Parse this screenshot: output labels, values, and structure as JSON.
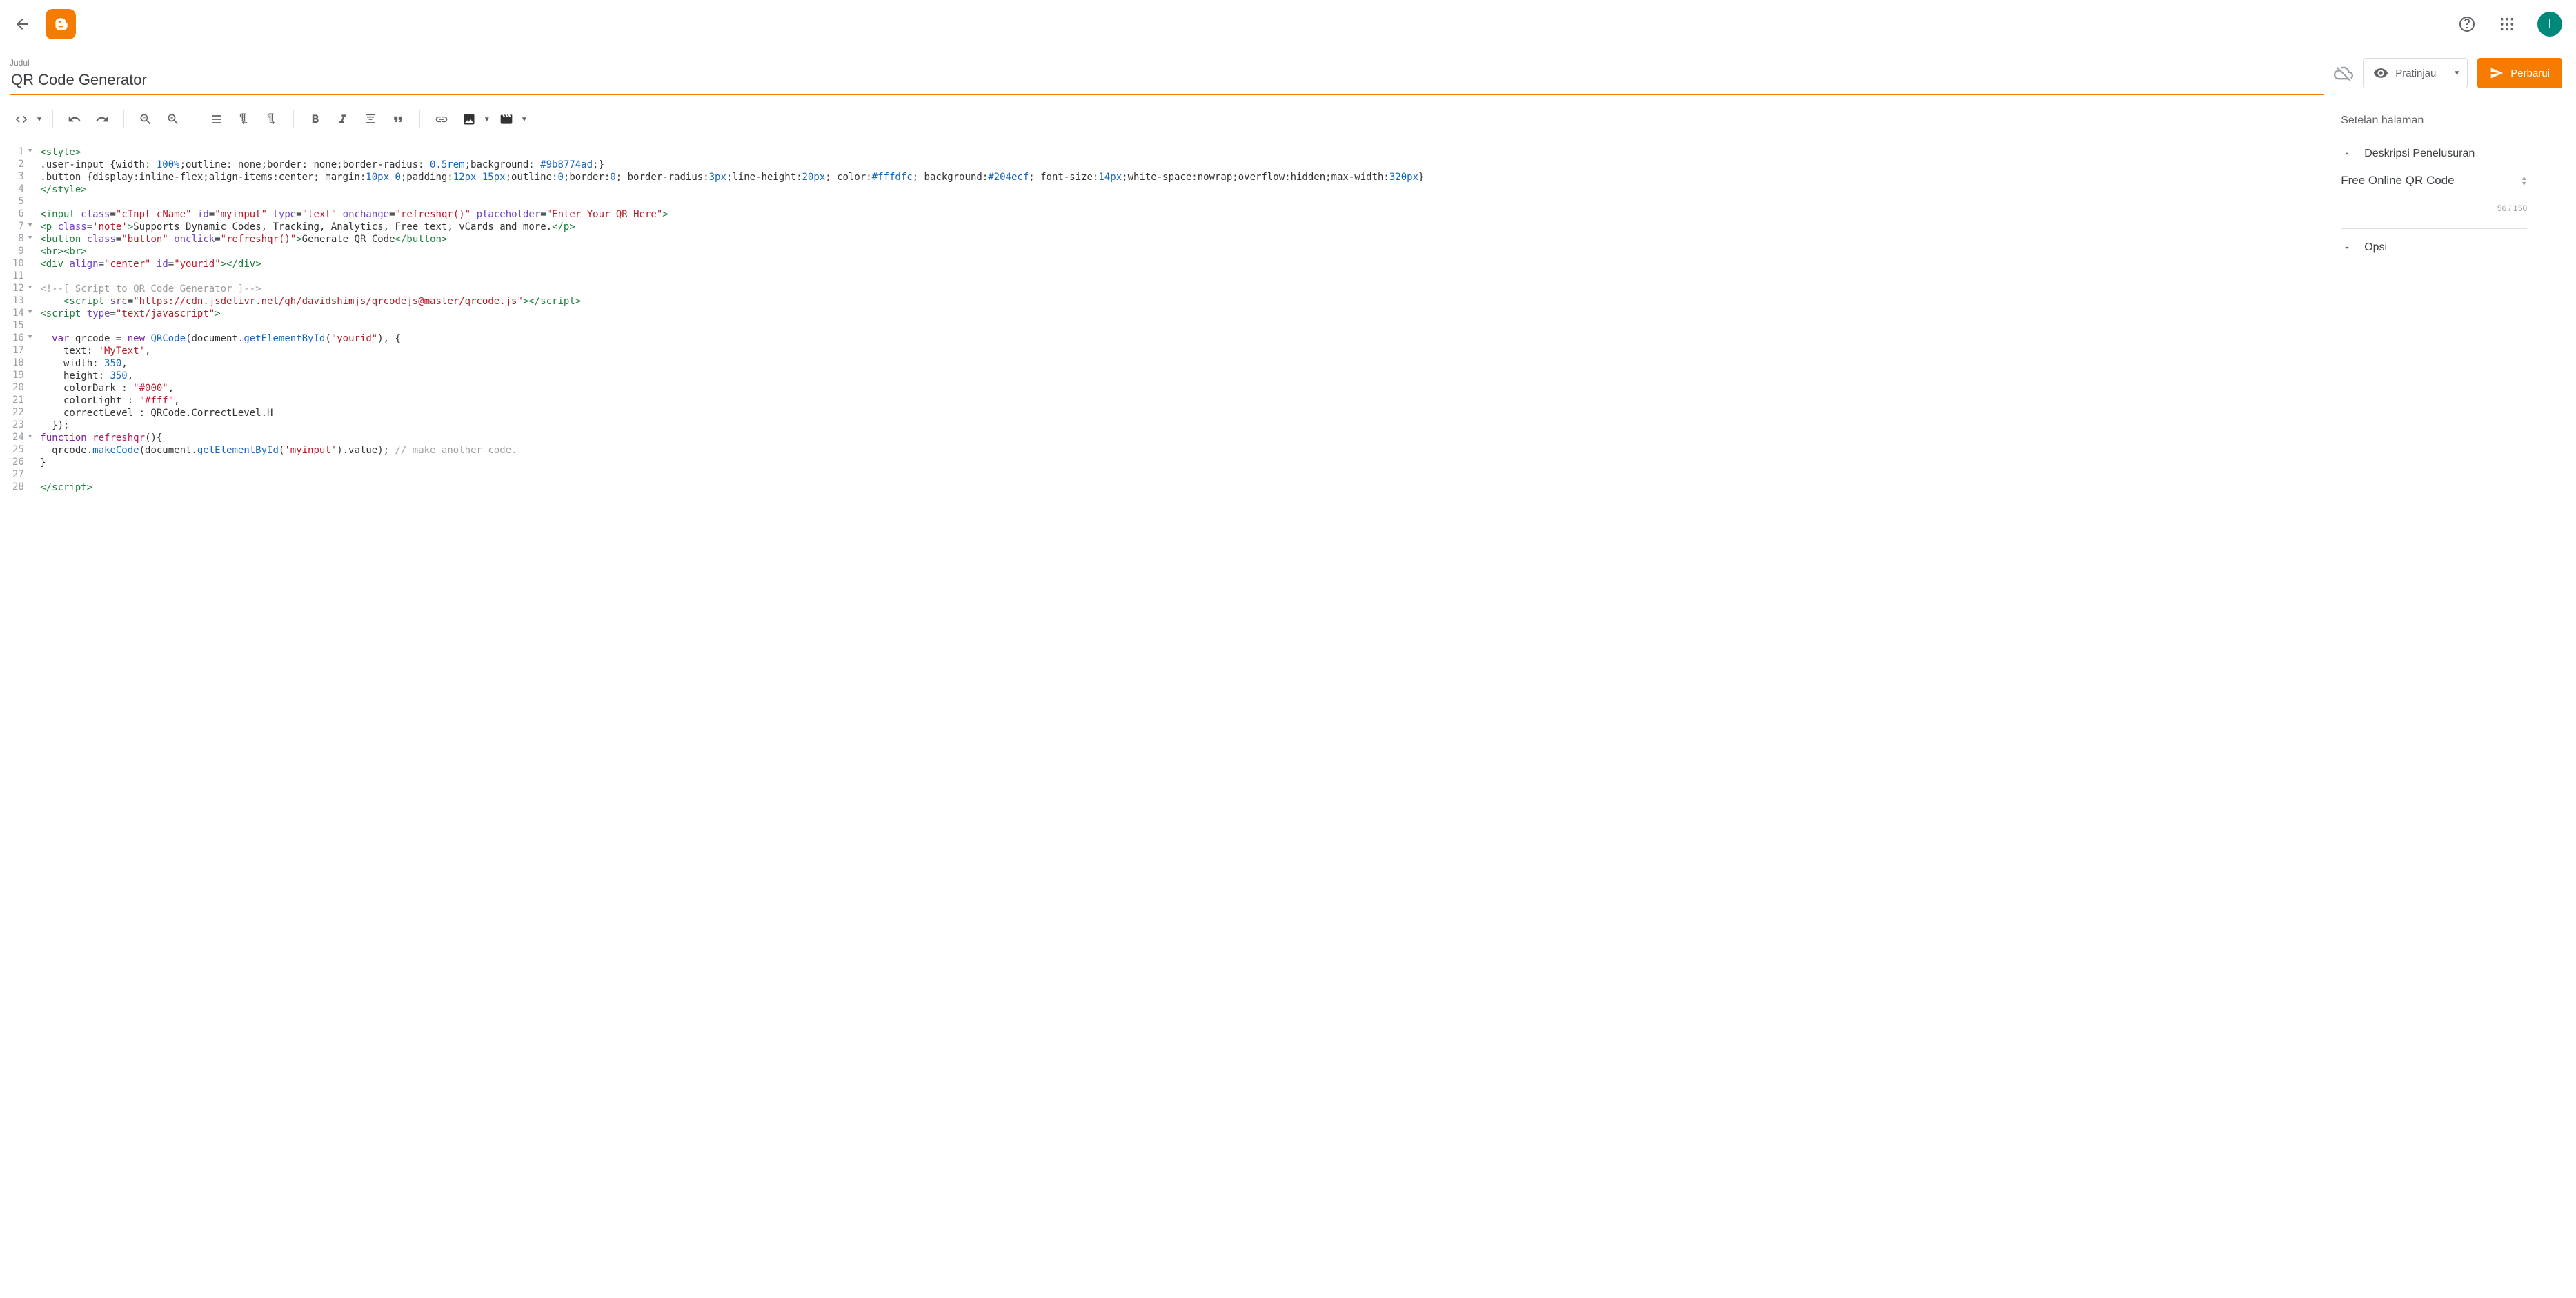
{
  "header": {
    "avatar_initial": "I"
  },
  "page": {
    "title_label": "Judul",
    "title_value": "QR Code Generator"
  },
  "actions": {
    "preview_label": "Pratinjau",
    "update_label": "Perbarui"
  },
  "right_panel": {
    "heading": "Setelan halaman",
    "search_description_label": "Deskripsi Penelusuran",
    "search_description_value": "Free Online QR Code",
    "char_count": "56 / 150",
    "options_label": "Opsi"
  },
  "code": {
    "lines": [
      {
        "n": "1",
        "fold": true,
        "html": "<span class='t-tag'>&lt;style&gt;</span>"
      },
      {
        "n": "2",
        "html": "<span class='t-txt'>.user-input {width: </span><span class='t-num'>100%</span><span class='t-txt'>;outline: none;border: none;border-radius: </span><span class='t-num'>0.5rem</span><span class='t-txt'>;background: </span><span class='t-num'>#9b8774ad</span><span class='t-txt'>;}</span>"
      },
      {
        "n": "3",
        "html": "<span class='t-txt'>.button {display:inline-flex;align-items:center; margin:</span><span class='t-num'>10px 0</span><span class='t-txt'>;padding:</span><span class='t-num'>12px 15px</span><span class='t-txt'>;outline:</span><span class='t-num'>0</span><span class='t-txt'>;border:</span><span class='t-num'>0</span><span class='t-txt'>; border-radius:</span><span class='t-num'>3px</span><span class='t-txt'>;line-height:</span><span class='t-num'>20px</span><span class='t-txt'>; color:</span><span class='t-num'>#fffdfc</span><span class='t-txt'>; background:</span><span class='t-num'>#204ecf</span><span class='t-txt'>; font-size:</span><span class='t-num'>14px</span><span class='t-txt'>;white-space:nowrap;overflow:hidden;max-width:</span><span class='t-num'>320px</span><span class='t-txt'>}</span>"
      },
      {
        "n": "4",
        "html": "<span class='t-tag'>&lt;/style&gt;</span>"
      },
      {
        "n": "5",
        "html": ""
      },
      {
        "n": "6",
        "html": "<span class='t-tag'>&lt;input</span> <span class='t-attr'>class</span>=<span class='t-str'>\"cInpt cName\"</span> <span class='t-attr'>id</span>=<span class='t-str'>\"myinput\"</span> <span class='t-attr'>type</span>=<span class='t-str'>\"text\"</span> <span class='t-attr'>onchange</span>=<span class='t-str'>\"refreshqr()\"</span> <span class='t-attr'>placeholder</span>=<span class='t-str'>\"Enter Your QR Here\"</span><span class='t-tag'>&gt;</span>"
      },
      {
        "n": "7",
        "fold": true,
        "html": "<span class='t-tag'>&lt;p</span> <span class='t-attr'>class</span>=<span class='t-str'>'note'</span><span class='t-tag'>&gt;</span><span class='t-txt'>Supports Dynamic Codes, Tracking, Analytics, Free text, vCards and more.</span><span class='t-tag'>&lt;/p&gt;</span>"
      },
      {
        "n": "8",
        "fold": true,
        "html": "<span class='t-tag'>&lt;button</span> <span class='t-attr'>class</span>=<span class='t-str'>\"button\"</span> <span class='t-attr'>onclick</span>=<span class='t-str'>\"refreshqr()\"</span><span class='t-tag'>&gt;</span><span class='t-txt'>Generate QR Code</span><span class='t-tag'>&lt;/button&gt;</span>"
      },
      {
        "n": "9",
        "html": "<span class='t-tag'>&lt;br&gt;&lt;br&gt;</span>"
      },
      {
        "n": "10",
        "html": "<span class='t-tag'>&lt;div</span> <span class='t-attr'>align</span>=<span class='t-str'>\"center\"</span> <span class='t-attr'>id</span>=<span class='t-str'>\"yourid\"</span><span class='t-tag'>&gt;&lt;/div&gt;</span>"
      },
      {
        "n": "11",
        "html": ""
      },
      {
        "n": "12",
        "fold": true,
        "html": "<span class='t-com'>&lt;!--[ Script to QR Code Generator ]--&gt;</span>"
      },
      {
        "n": "13",
        "html": "    <span class='t-tag'>&lt;script</span> <span class='t-attr'>src</span>=<span class='t-str'>\"https://cdn.jsdelivr.net/gh/davidshimjs/qrcodejs@master/qrcode.js\"</span><span class='t-tag'>&gt;&lt;/script&gt;</span>"
      },
      {
        "n": "14",
        "fold": true,
        "html": "<span class='t-tag'>&lt;script</span> <span class='t-attr'>type</span>=<span class='t-str'>\"text/javascript\"</span><span class='t-tag'>&gt;</span>"
      },
      {
        "n": "15",
        "html": ""
      },
      {
        "n": "16",
        "fold": true,
        "html": "  <span class='t-kw'>var</span> <span class='t-txt'>qrcode = </span><span class='t-kw'>new</span> <span class='t-fn'>QRCode</span><span class='t-txt'>(document.</span><span class='t-fn'>getElementById</span><span class='t-txt'>(</span><span class='t-str'>\"yourid\"</span><span class='t-txt'>), {</span>"
      },
      {
        "n": "17",
        "html": "    <span class='t-txt'>text: </span><span class='t-str'>'MyText'</span><span class='t-txt'>,</span>"
      },
      {
        "n": "18",
        "html": "    <span class='t-txt'>width: </span><span class='t-num'>350</span><span class='t-txt'>,</span>"
      },
      {
        "n": "19",
        "html": "    <span class='t-txt'>height: </span><span class='t-num'>350</span><span class='t-txt'>,</span>"
      },
      {
        "n": "20",
        "html": "    <span class='t-txt'>colorDark : </span><span class='t-str'>\"#000\"</span><span class='t-txt'>,</span>"
      },
      {
        "n": "21",
        "html": "    <span class='t-txt'>colorLight : </span><span class='t-str'>\"#fff\"</span><span class='t-txt'>,</span>"
      },
      {
        "n": "22",
        "html": "    <span class='t-txt'>correctLevel : QRCode.CorrectLevel.H</span>"
      },
      {
        "n": "23",
        "html": "  <span class='t-txt'>});</span>"
      },
      {
        "n": "24",
        "fold": true,
        "html": "<span class='t-kw'>function</span> <span class='t-id'>refreshqr</span><span class='t-txt'>(){</span>"
      },
      {
        "n": "25",
        "html": "  <span class='t-txt'>qrcode.</span><span class='t-fn'>makeCode</span><span class='t-txt'>(document.</span><span class='t-fn'>getElementById</span><span class='t-txt'>(</span><span class='t-str'>'myinput'</span><span class='t-txt'>).value); </span><span class='t-com'>// make another code.</span>"
      },
      {
        "n": "26",
        "html": "<span class='t-txt'>}</span>"
      },
      {
        "n": "27",
        "html": ""
      },
      {
        "n": "28",
        "html": "<span class='t-tag'>&lt;/script&gt;</span>"
      }
    ]
  }
}
